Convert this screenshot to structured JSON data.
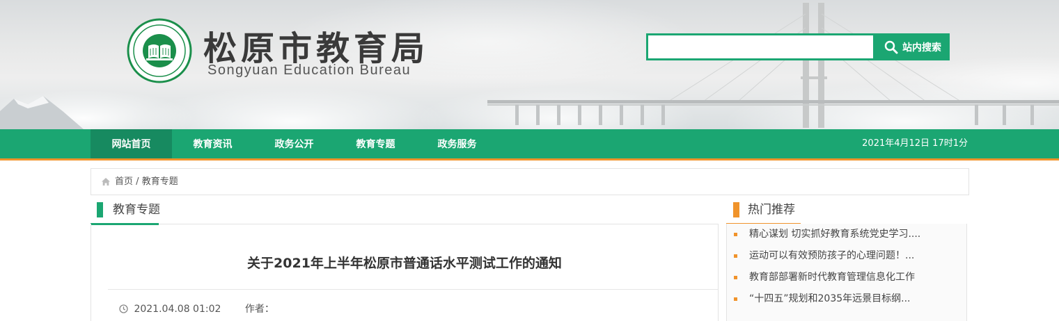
{
  "header": {
    "logo_cn": "松原市教育局",
    "logo_en": "Songyuan Education Bureau",
    "seal_text": "松原市教育局 SONGYUAN BUREAU OF EDUCATION"
  },
  "search": {
    "placeholder": "",
    "value": "",
    "button_label": "站内搜索"
  },
  "nav": {
    "items": [
      {
        "label": "网站首页",
        "active": true
      },
      {
        "label": "教育资讯",
        "active": false
      },
      {
        "label": "政务公开",
        "active": false
      },
      {
        "label": "教育专题",
        "active": false
      },
      {
        "label": "政务服务",
        "active": false
      }
    ],
    "date": "2021年4月12日 17时1分"
  },
  "breadcrumb": {
    "home": "首页",
    "separator": "/",
    "current": "教育专题"
  },
  "main": {
    "section_title": "教育专题",
    "article": {
      "title": "关于2021年上半年松原市普通话水平测试工作的通知",
      "date": "2021.04.08 01:02",
      "author_label": "作者："
    }
  },
  "sidebar": {
    "title": "热门推荐",
    "items": [
      {
        "label": "精心谋划 切实抓好教育系统党史学习...."
      },
      {
        "label": "运动可以有效预防孩子的心理问题！..."
      },
      {
        "label": "教育部部署新时代教育管理信息化工作"
      },
      {
        "label": "“十四五”规划和2035年远景目标纲..."
      }
    ]
  },
  "colors": {
    "primary_green": "#1ba672",
    "nav_active": "#178a60",
    "accent_orange": "#f0932b"
  }
}
